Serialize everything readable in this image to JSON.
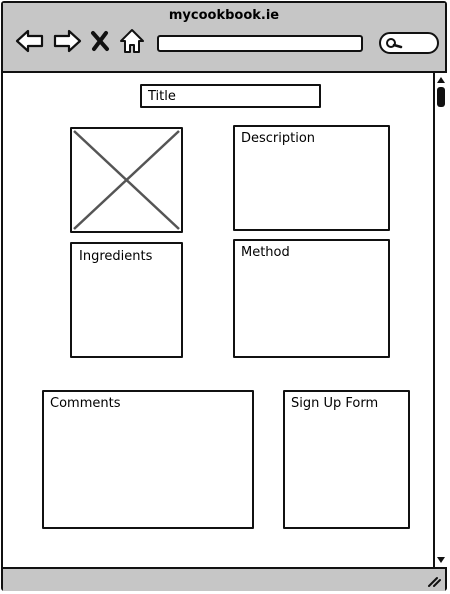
{
  "browser": {
    "site_title": "mycookbook.ie",
    "address_value": "",
    "search_value": ""
  },
  "page": {
    "title_label": "Title",
    "description_label": "Description",
    "ingredients_label": "Ingredients",
    "method_label": "Method",
    "comments_label": "Comments",
    "signup_label": "Sign Up Form"
  },
  "icons": {
    "back": "back-arrow-icon",
    "forward": "forward-arrow-icon",
    "stop": "close-icon",
    "home": "home-icon",
    "search": "search-icon",
    "image": "image-placeholder-icon",
    "resize": "resize-grip-icon"
  },
  "colors": {
    "chrome": "#c6c6c6",
    "border": "#111111",
    "placeholder_cross": "#555555"
  }
}
